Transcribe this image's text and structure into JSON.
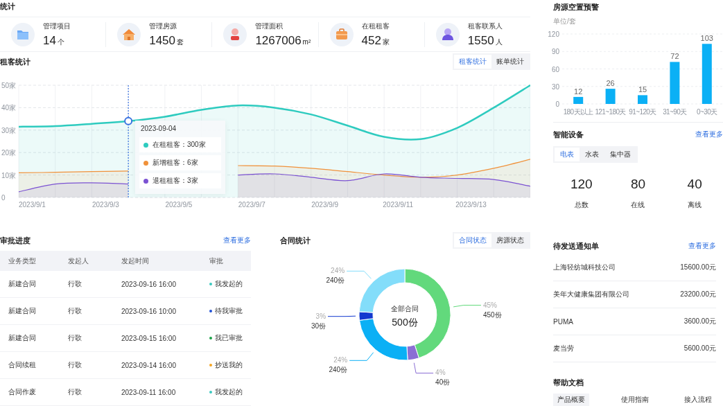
{
  "overview": {
    "title": "统计",
    "stats": [
      {
        "kind": "folder",
        "label": "管理项目",
        "value": "14",
        "unit": "个"
      },
      {
        "kind": "house",
        "label": "管理房源",
        "value": "1450",
        "unit": "套"
      },
      {
        "kind": "pin",
        "label": "管理面积",
        "value": "1267006",
        "unit": "m²"
      },
      {
        "kind": "briefcase",
        "label": "在租租客",
        "value": "452",
        "unit": "家"
      },
      {
        "kind": "person",
        "label": "租客联系人",
        "value": "1550",
        "unit": "人"
      }
    ]
  },
  "tenants": {
    "title": "租客统计",
    "toggle": [
      {
        "label": "租客统计",
        "selected": true
      },
      {
        "label": "账单统计",
        "selected": false
      }
    ],
    "chart_data": {
      "type": "area",
      "grid": true,
      "categories": [
        "2023/9/1",
        null,
        "2023/9/3",
        null,
        "2023/9/5",
        null,
        "2023/9/7",
        null,
        "2023/9/9",
        null,
        "2023/9/11",
        null,
        "2023/9/13",
        null,
        null
      ],
      "yticks": [
        {
          "value": 0,
          "label": "0"
        },
        {
          "value": 10,
          "label": "10家"
        },
        {
          "value": 20,
          "label": "20家"
        },
        {
          "value": 30,
          "label": "30家"
        },
        {
          "value": 40,
          "label": "40家"
        },
        {
          "value": 50,
          "label": "50家"
        }
      ],
      "ylim": [
        0,
        50
      ],
      "series": [
        {
          "name": "在租租客",
          "color": "#2ecbbf",
          "values": [
            31.5,
            31.8,
            32.8,
            34,
            36,
            39,
            41,
            40,
            37,
            32,
            27,
            26,
            31,
            40,
            50
          ]
        },
        {
          "name": "新增租客",
          "color": "#f0913a",
          "values": [
            11,
            11.2,
            11.5,
            11.8,
            null,
            null,
            14.2,
            14,
            13,
            11.5,
            10,
            9,
            10,
            13,
            17
          ]
        },
        {
          "name": "退租租客",
          "color": "#7b52d2",
          "values": [
            2.5,
            6,
            6.5,
            6,
            null,
            null,
            10,
            10.5,
            9,
            7.5,
            10.5,
            9,
            8.5,
            8,
            5
          ]
        }
      ]
    },
    "tooltip": {
      "date": "2023-09-04",
      "rows": [
        {
          "value": "：300家"
        },
        {
          "value": "：6家"
        },
        {
          "value": "：3家"
        }
      ]
    }
  },
  "approvals": {
    "title": "审批进度",
    "more": "查看更多",
    "columns": [
      "业务类型",
      "发起人",
      "发起时间",
      "审批"
    ],
    "rows": [
      {
        "type": "新建合同",
        "initiator": "行歌",
        "time": "2023-09-16 16:00",
        "status": "我发起的",
        "color": "#3cc9c0"
      },
      {
        "type": "新建合同",
        "initiator": "行歌",
        "time": "2023-09-16 10:00",
        "status": "待我审批",
        "color": "#2453d6"
      },
      {
        "type": "新建合同",
        "initiator": "行歌",
        "time": "2023-09-15 16:00",
        "status": "我已审批",
        "color": "#1ea34a"
      },
      {
        "type": "合同续租",
        "initiator": "行歌",
        "time": "2023-09-14 16:00",
        "status": "抄送我的",
        "color": "#f5a623"
      },
      {
        "type": "合同作废",
        "initiator": "行歌",
        "time": "2023-09-11 16:00",
        "status": "我发起的",
        "color": "#3cc9c0"
      }
    ]
  },
  "contracts": {
    "title": "合同统计",
    "toggle": [
      {
        "label": "合同状态",
        "selected": true
      },
      {
        "label": "房源状态",
        "selected": false
      }
    ],
    "center_label": "全部合同",
    "center_value": "500份",
    "chart_data": {
      "type": "donut",
      "values": [
        45,
        4,
        24,
        3,
        24
      ],
      "value_labels": [
        "45%",
        "4%",
        "24%",
        "3%",
        "24%"
      ]
    },
    "slices": [
      {
        "count": "450份",
        "color": "#62d97c"
      },
      {
        "count": "40份",
        "color": "#8b6fd4"
      },
      {
        "count": "240份",
        "color": "#0bb0f5"
      },
      {
        "count": "30份",
        "color": "#1238cf"
      },
      {
        "count": "240份",
        "color": "#83ddfa"
      }
    ]
  },
  "vacancy": {
    "title": "房源空置预警",
    "unit": "单位/套",
    "chart_data": {
      "type": "bar",
      "categories": [
        "180天以上",
        "121~180天",
        "91~120天",
        "31~90天",
        "0~30天"
      ],
      "values": [
        12,
        26,
        15,
        72,
        103
      ],
      "ylim": [
        0,
        120
      ],
      "grid": true,
      "yticks": [
        0,
        30,
        60,
        90,
        120
      ],
      "data_labels": true
    }
  },
  "devices": {
    "title": "智能设备",
    "more": "查看更多",
    "tabs": [
      {
        "label": "电表",
        "selected": true
      },
      {
        "label": "水表",
        "selected": false
      },
      {
        "label": "集中器",
        "selected": false
      }
    ],
    "stats": [
      {
        "value": "120",
        "label": "总数"
      },
      {
        "value": "80",
        "label": "在线"
      },
      {
        "value": "40",
        "label": "离线"
      }
    ]
  },
  "notices": {
    "title": "待发送通知单",
    "more": "查看更多",
    "rows": [
      {
        "name": "上海轻纺城科技公司",
        "amount": "15600.00元"
      },
      {
        "name": "美年大健康集团有限公司",
        "amount": "23200.00元"
      },
      {
        "name": "PUMA",
        "amount": "3600.00元"
      },
      {
        "name": "麦当劳",
        "amount": "5600.00元"
      }
    ]
  },
  "help": {
    "title": "帮助文档",
    "tabs": [
      {
        "label": "产品概要",
        "selected": true
      },
      {
        "label": "使用指南",
        "selected": false
      },
      {
        "label": "接入流程",
        "selected": false
      }
    ]
  }
}
